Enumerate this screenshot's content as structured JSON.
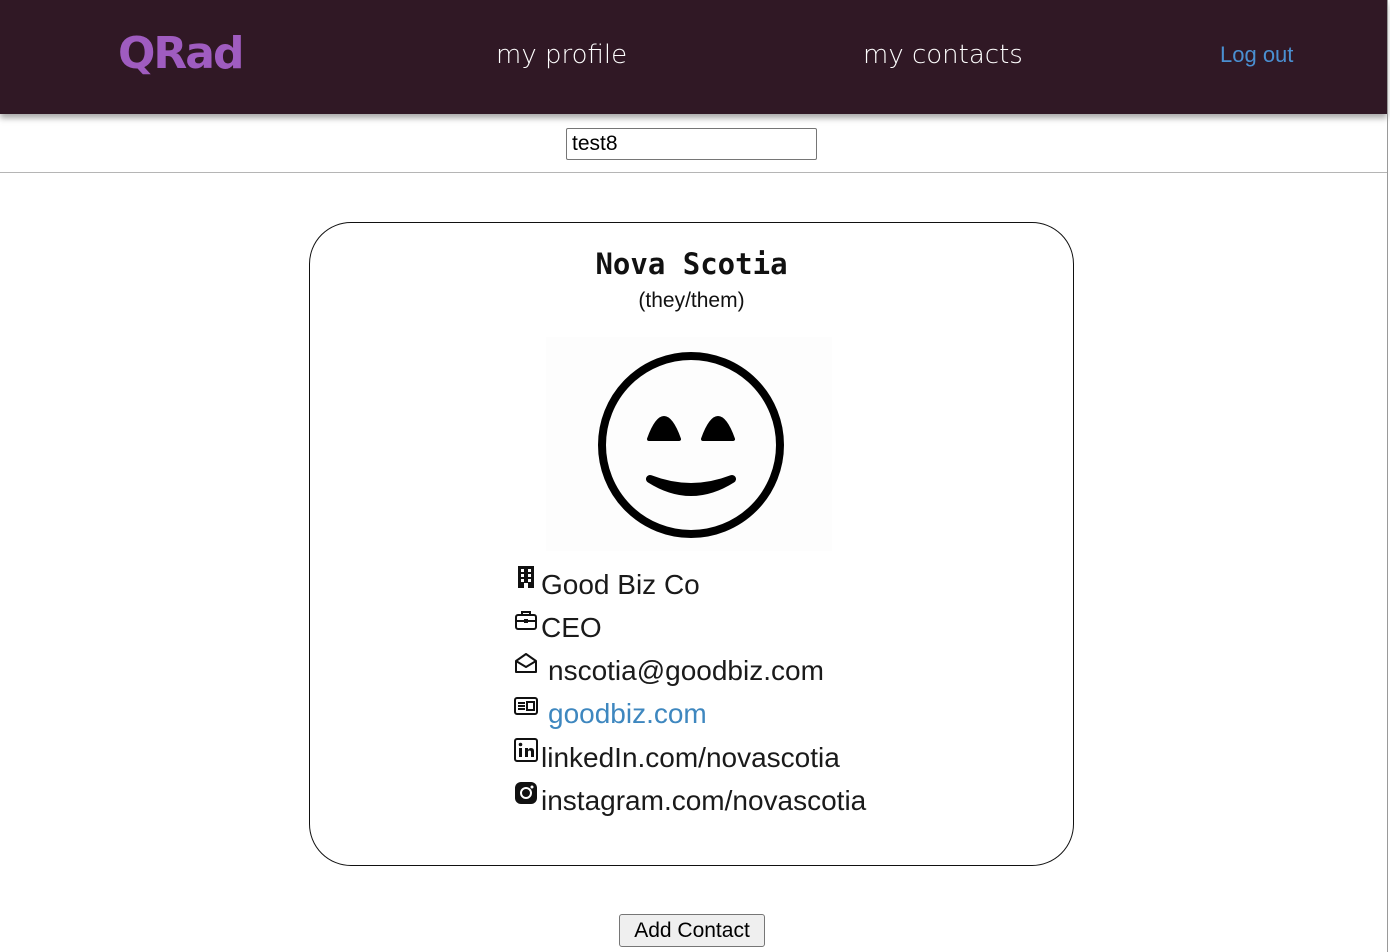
{
  "nav": {
    "logo": "QRad",
    "my_profile": "my profile",
    "my_contacts": "my contacts",
    "logout": "Log out"
  },
  "search": {
    "value": "test8"
  },
  "card": {
    "name": "Nova Scotia",
    "pronouns": "(they/them)",
    "avatar_icon": "smiling-face-icon",
    "company": "Good Biz Co",
    "title": "CEO",
    "email": "nscotia@goodbiz.com",
    "website": "goodbiz.com",
    "linkedin": "linkedIn.com/novascotia",
    "instagram": "instagram.com/novascotia"
  },
  "actions": {
    "add_contact": "Add Contact"
  },
  "colors": {
    "navbar": "#301825",
    "logo": "#9f5cc0",
    "link": "#3e87bf",
    "nav_text": "#ffffff"
  }
}
